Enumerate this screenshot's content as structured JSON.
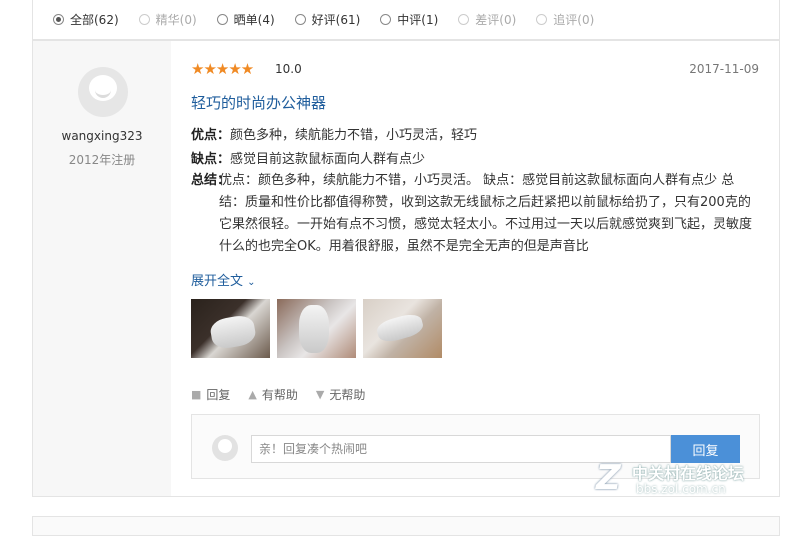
{
  "filters": [
    {
      "label": "全部(62)",
      "checked": true,
      "disabled": false
    },
    {
      "label": "精华(0)",
      "checked": false,
      "disabled": true
    },
    {
      "label": "晒单(4)",
      "checked": false,
      "disabled": false
    },
    {
      "label": "好评(61)",
      "checked": false,
      "disabled": false
    },
    {
      "label": "中评(1)",
      "checked": false,
      "disabled": false
    },
    {
      "label": "差评(0)",
      "checked": false,
      "disabled": true
    },
    {
      "label": "追评(0)",
      "checked": false,
      "disabled": true
    }
  ],
  "review": {
    "user": {
      "name": "wangxing323",
      "registered": "2012年注册"
    },
    "stars": "★★★★★",
    "rating": 5,
    "score": "10.0",
    "date": "2017-11-09",
    "title": "轻巧的时尚办公神器",
    "pros_key": "优点：",
    "pros": "颜色多种，续航能力不错，小巧灵活，轻巧",
    "cons_key": "缺点：",
    "cons": "感觉目前这款鼠标面向人群有点少",
    "summary_key": "总结：",
    "summary": "优点：颜色多种，续航能力不错，小巧灵活。 缺点：感觉目前这款鼠标面向人群有点少 总结：质量和性价比都值得称赞，收到这款无线鼠标之后赶紧把以前鼠标给扔了，只有200克的它果然很轻。一开始有点不习惯，感觉太轻太小。不过用过一天以后就感觉爽到飞起，灵敏度什么的也完全OK。用着很舒服，虽然不是完全无声的但是声音比",
    "expand": "展开全文",
    "actions": {
      "reply": "回复",
      "helpful": "有帮助",
      "unhelpful": "无帮助"
    },
    "reply_placeholder": "亲！回复凑个热闹吧",
    "reply_button": "回复"
  },
  "watermark": {
    "logo": "Z",
    "name": "中关村在线论坛",
    "url": "bbs.zol.com.cn"
  },
  "colors": {
    "accent": "#4b90d8",
    "star": "#f08a24",
    "title": "#1f5d9c"
  }
}
